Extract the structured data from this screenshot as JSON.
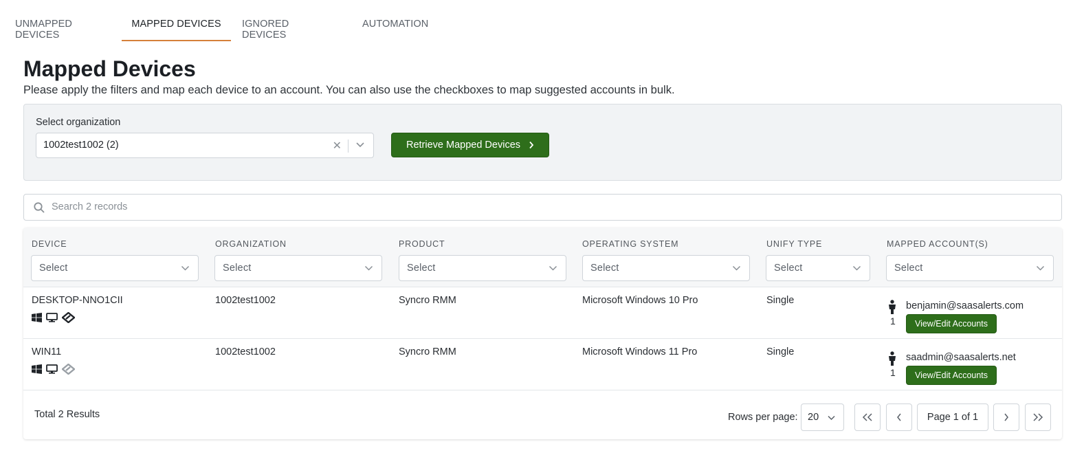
{
  "tabs": [
    {
      "label": "UNMAPPED DEVICES",
      "active": false
    },
    {
      "label": "MAPPED DEVICES",
      "active": true
    },
    {
      "label": "IGNORED DEVICES",
      "active": false
    },
    {
      "label": "AUTOMATION",
      "active": false
    }
  ],
  "page": {
    "title": "Mapped Devices",
    "subtitle": "Please apply the filters and map each device to an account. You can also use the checkboxes to map suggested accounts in bulk."
  },
  "filters": {
    "org_label": "Select organization",
    "org_value": "1002test1002 (2)",
    "retrieve_label": "Retrieve Mapped Devices"
  },
  "search": {
    "placeholder": "Search 2 records"
  },
  "table": {
    "columns": [
      {
        "label": "DEVICE",
        "select": "Select"
      },
      {
        "label": "ORGANIZATION",
        "select": "Select"
      },
      {
        "label": "PRODUCT",
        "select": "Select"
      },
      {
        "label": "OPERATING SYSTEM",
        "select": "Select"
      },
      {
        "label": "UNIFY TYPE",
        "select": "Select"
      },
      {
        "label": "MAPPED ACCOUNT(S)",
        "select": "Select"
      }
    ],
    "rows": [
      {
        "device": "DESKTOP-NNO1CII",
        "organization": "1002test1002",
        "product": "Syncro RMM",
        "os": "Microsoft Windows 10 Pro",
        "unify_type": "Single",
        "account_count": "1",
        "account_email": "benjamin@saasalerts.com",
        "button": "View/Edit Accounts",
        "icons": [
          "windows-icon",
          "desktop-icon",
          "syncro-icon"
        ]
      },
      {
        "device": "WIN11",
        "organization": "1002test1002",
        "product": "Syncro RMM",
        "os": "Microsoft Windows 11 Pro",
        "unify_type": "Single",
        "account_count": "1",
        "account_email": "saadmin@saasalerts.net",
        "button": "View/Edit Accounts",
        "icons": [
          "windows-icon",
          "desktop-icon",
          "syncro-icon"
        ]
      }
    ]
  },
  "footer": {
    "total_prefix": "Total",
    "total_count": "2",
    "total_suffix": "Results",
    "rows_per_page_label": "Rows per page:",
    "rows_per_page_value": "20",
    "page_indicator": "Page 1 of 1"
  },
  "colors": {
    "accent_tab": "#d5803a",
    "button_green": "#2e6e1b"
  }
}
